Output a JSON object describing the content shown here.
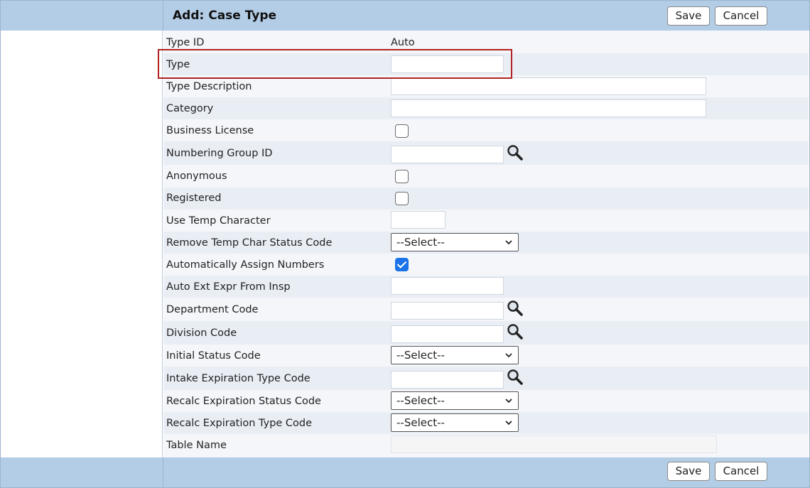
{
  "header": {
    "title": "Add: Case Type",
    "save_label": "Save",
    "cancel_label": "Cancel"
  },
  "footer": {
    "save_label": "Save",
    "cancel_label": "Cancel"
  },
  "fields": {
    "type_id": {
      "label": "Type ID",
      "value": "Auto"
    },
    "type": {
      "label": "Type",
      "value": ""
    },
    "type_description": {
      "label": "Type Description",
      "value": ""
    },
    "category": {
      "label": "Category",
      "value": ""
    },
    "business_license": {
      "label": "Business License",
      "checked": false
    },
    "numbering_group_id": {
      "label": "Numbering Group ID",
      "value": ""
    },
    "anonymous": {
      "label": "Anonymous",
      "checked": false
    },
    "registered": {
      "label": "Registered",
      "checked": false
    },
    "use_temp_character": {
      "label": "Use Temp Character",
      "value": ""
    },
    "remove_temp_char_status_code": {
      "label": "Remove Temp Char Status Code",
      "selected": "--Select--"
    },
    "automatically_assign_numbers": {
      "label": "Automatically Assign Numbers",
      "checked": true
    },
    "auto_ext_expr_from_insp": {
      "label": "Auto Ext Expr From Insp",
      "value": ""
    },
    "department_code": {
      "label": "Department Code",
      "value": ""
    },
    "division_code": {
      "label": "Division Code",
      "value": ""
    },
    "initial_status_code": {
      "label": "Initial Status Code",
      "selected": "--Select--"
    },
    "intake_expiration_type_code": {
      "label": "Intake Expiration Type Code",
      "value": ""
    },
    "recalc_expiration_status_code": {
      "label": "Recalc Expiration Status Code",
      "selected": "--Select--"
    },
    "recalc_expiration_type_code": {
      "label": "Recalc Expiration Type Code",
      "selected": "--Select--"
    },
    "table_name": {
      "label": "Table Name",
      "value": ""
    }
  },
  "icons": {
    "lookup": "magnifier-icon",
    "dropdown": "chevron-down-icon",
    "checkmark": "checkmark-icon"
  },
  "colors": {
    "header_bar": "#b3cde6",
    "row_alt": "#e9eef5",
    "highlight_border": "#b22222",
    "checkbox_checked": "#1a73e8"
  }
}
